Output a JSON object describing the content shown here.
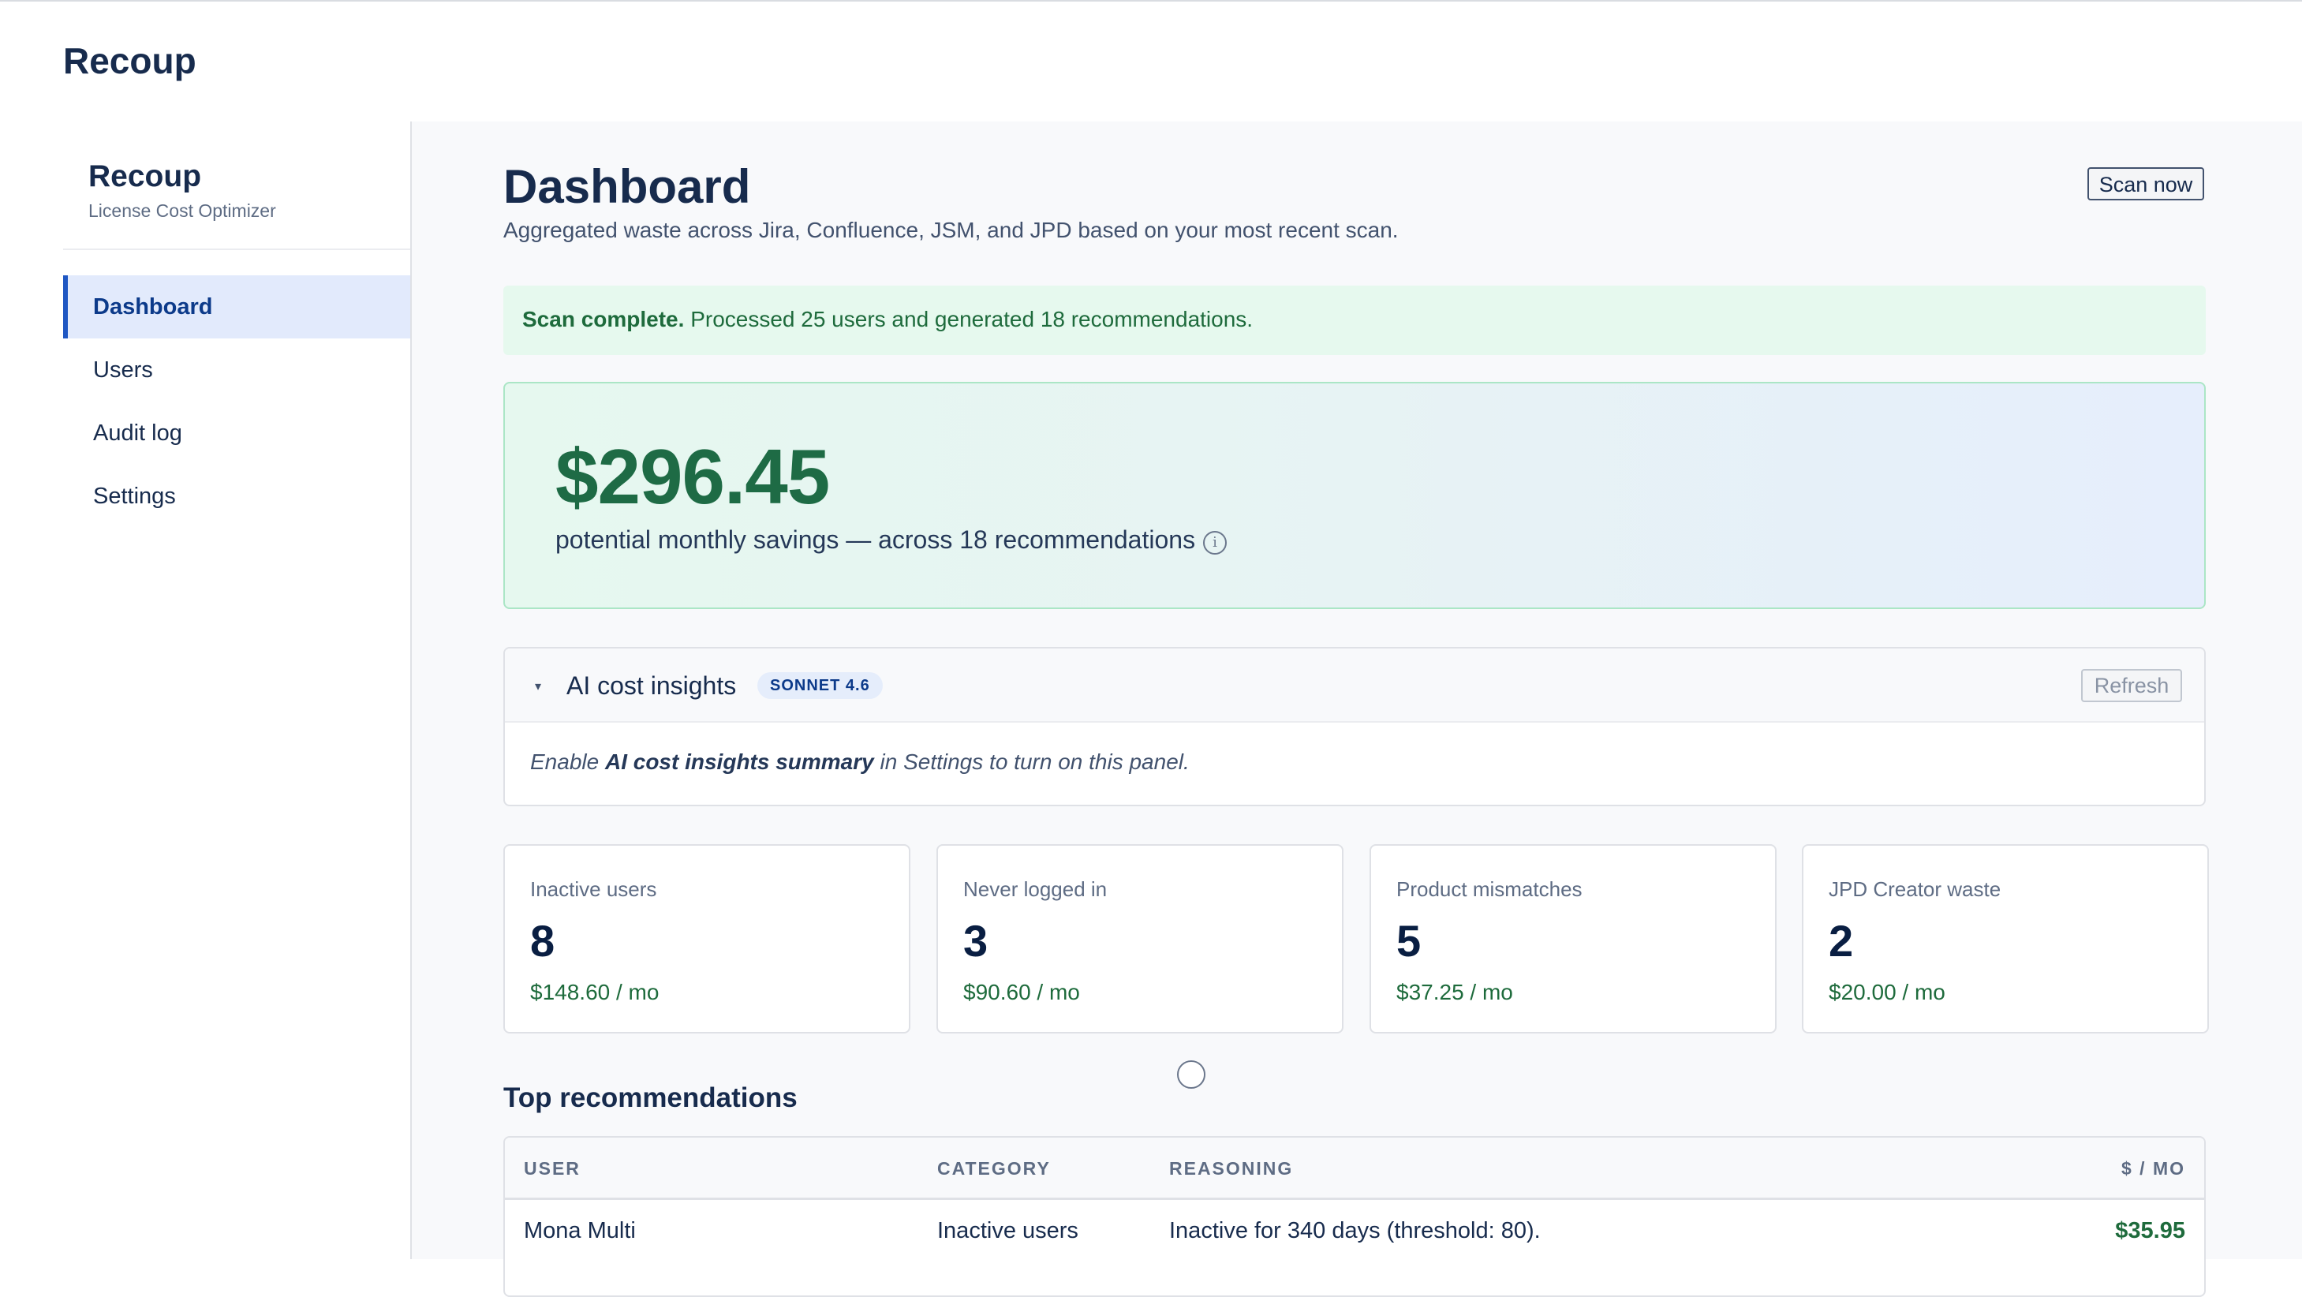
{
  "app": {
    "title": "Recoup"
  },
  "sidebar": {
    "title": "Recoup",
    "subtitle": "License Cost Optimizer",
    "items": [
      {
        "label": "Dashboard",
        "active": true
      },
      {
        "label": "Users",
        "active": false
      },
      {
        "label": "Audit log",
        "active": false
      },
      {
        "label": "Settings",
        "active": false
      }
    ]
  },
  "header": {
    "title": "Dashboard",
    "subtitle": "Aggregated waste across Jira, Confluence, JSM, and JPD based on your most recent scan.",
    "scan_button": "Scan now"
  },
  "banner": {
    "strong": "Scan complete.",
    "text": "Processed 25 users and generated 18 recommendations."
  },
  "savings": {
    "amount": "$296.45",
    "text": "potential monthly savings — across 18 recommendations",
    "info_icon": "info-icon"
  },
  "ai_insights": {
    "caret": "▾",
    "title": "AI cost insights",
    "badge": "SONNET 4.6",
    "refresh_button": "Refresh",
    "body_prefix": "Enable ",
    "body_strong": "AI cost insights summary",
    "body_suffix": " in Settings to turn on this panel."
  },
  "stats": [
    {
      "label": "Inactive users",
      "value": "8",
      "cost": "$148.60 / mo"
    },
    {
      "label": "Never logged in",
      "value": "3",
      "cost": "$90.60 / mo"
    },
    {
      "label": "Product mismatches",
      "value": "5",
      "cost": "$37.25 / mo"
    },
    {
      "label": "JPD Creator waste",
      "value": "2",
      "cost": "$20.00 / mo"
    }
  ],
  "recommendations": {
    "title": "Top recommendations",
    "columns": [
      "USER",
      "CATEGORY",
      "REASONING",
      "$ / MO"
    ],
    "rows": [
      {
        "user": "Mona Multi",
        "category": "Inactive users",
        "reasoning": "Inactive for 340 days (threshold: 80).",
        "amount": "$35.95"
      }
    ]
  },
  "colors": {
    "accent": "#1f57c3",
    "success": "#1e6b3c",
    "banner_bg": "#e6f9ee"
  }
}
